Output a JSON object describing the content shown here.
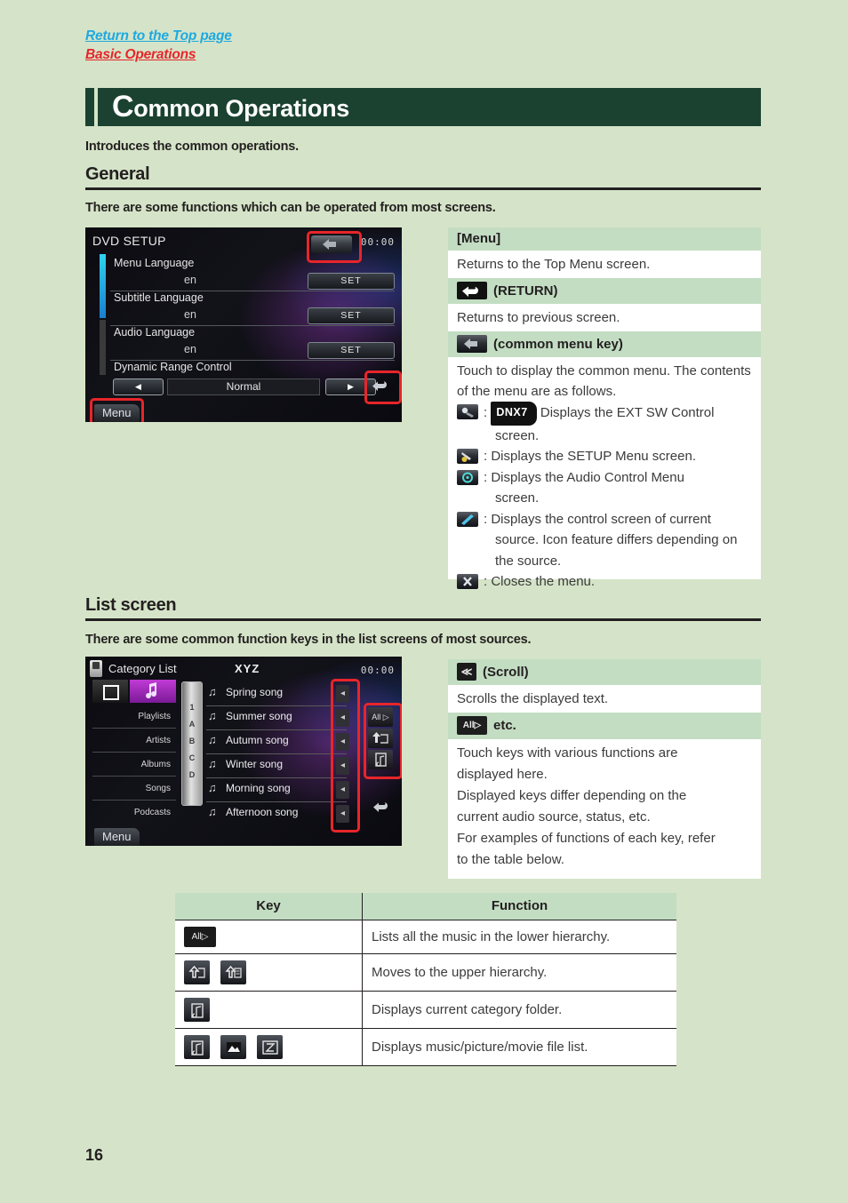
{
  "top_links": [
    {
      "label": "Return to the Top page",
      "color": "#1ea9e1"
    },
    {
      "label": "Basic Operations",
      "color": "#e8252a"
    }
  ],
  "chapter": {
    "initial": "C",
    "rest": "ommon Operations",
    "intro": "Introduces the common operations."
  },
  "sections": [
    {
      "heading": "General",
      "subtitle": "There are some functions which can be operated from most screens."
    },
    {
      "heading": "List screen",
      "subtitle": "There are some common function keys in the list screens of most sources."
    }
  ],
  "dvd_screen": {
    "title": "DVD SETUP",
    "clock": "00:00",
    "rows": [
      {
        "label": "Menu Language",
        "value": "en",
        "button": "SET"
      },
      {
        "label": "Subtitle Language",
        "value": "en",
        "button": "SET"
      },
      {
        "label": "Audio Language",
        "value": "en",
        "button": "SET"
      }
    ],
    "drc": {
      "label": "Dynamic Range Control",
      "value": "Normal",
      "left": "◀",
      "right": "▶"
    },
    "menu_key": "Menu",
    "common_menu_icon": "common-menu-key-icon",
    "return_icon": "return-icon"
  },
  "general_panel": {
    "entries": [
      {
        "key_text": "[Menu]",
        "key_icon": "",
        "body": "Returns to the Top Menu screen."
      },
      {
        "key_text": "(RETURN)",
        "key_icon": "return-icon",
        "body": "Returns to previous screen."
      },
      {
        "key_text": "(common menu key)",
        "key_icon": "common-menu-key-icon",
        "body": "Touch to display the common menu. The contents of the menu are as follows."
      }
    ],
    "bullets": [
      {
        "icon": "ext-sw-icon",
        "badge": "DNX7",
        "text": "Displays the EXT SW Control",
        "cont": "screen."
      },
      {
        "icon": "setup-wrench-icon",
        "badge": "",
        "text": "Displays the SETUP Menu screen.",
        "cont": ""
      },
      {
        "icon": "audio-control-icon",
        "badge": "",
        "text": "Displays the Audio Control Menu",
        "cont": "screen."
      },
      {
        "icon": "source-control-icon",
        "badge": "",
        "text": "Displays the control screen of current",
        "cont": "source. Icon feature differs depending on the source."
      },
      {
        "icon": "close-menu-icon",
        "badge": "",
        "text": "Closes the menu.",
        "cont": ""
      }
    ]
  },
  "list_screen": {
    "title": "Category List",
    "center_title": "XYZ",
    "clock": "00:00",
    "tabs": [
      "square-icon",
      "music-note-icon"
    ],
    "categories": [
      "Playlists",
      "Artists",
      "Albums",
      "Songs",
      "Podcasts"
    ],
    "alphabet": [
      "1",
      "A",
      "B",
      "C",
      "D"
    ],
    "songs": [
      "Spring song",
      "Summer song",
      "Autumn song",
      "Winter song",
      "Morning song",
      "Afternoon song"
    ],
    "side_keys": [
      "All ▷",
      "up-hierarchy-icon",
      "category-folder-icon"
    ],
    "menu_key": "Menu",
    "scroll_key": "◂"
  },
  "list_panel": {
    "entries": [
      {
        "key_text": "(Scroll)",
        "key_icon": "scroll-icon",
        "body": "Scrolls the displayed text."
      },
      {
        "key_text": "etc.",
        "key_icon": "all-key-icon",
        "body_lines": [
          "Touch keys with various functions are",
          "displayed here.",
          "Displayed keys differ depending on the",
          "current audio source, status, etc.",
          "For examples of functions of each key, refer",
          "to the table below."
        ]
      }
    ]
  },
  "key_table": {
    "headers": [
      "Key",
      "Function"
    ],
    "rows": [
      {
        "icons": [
          "all-key-icon"
        ],
        "function": "Lists all the music in the lower hierarchy."
      },
      {
        "icons": [
          "up-folder-icon",
          "up-list-icon"
        ],
        "function": "Moves to the upper hierarchy."
      },
      {
        "icons": [
          "category-folder-icon"
        ],
        "function": "Displays current category folder."
      },
      {
        "icons": [
          "music-file-icon",
          "picture-file-icon",
          "movie-file-icon"
        ],
        "function": "Displays music/picture/movie file list."
      }
    ]
  },
  "page_number": "16",
  "colors": {
    "background": "#d5e4c8",
    "chapter_bar": "#1b4230",
    "panel_header": "#c3ddc3",
    "link_blue": "#1ea9e1",
    "link_red": "#e8252a",
    "highlight_box": "#e8252a"
  }
}
